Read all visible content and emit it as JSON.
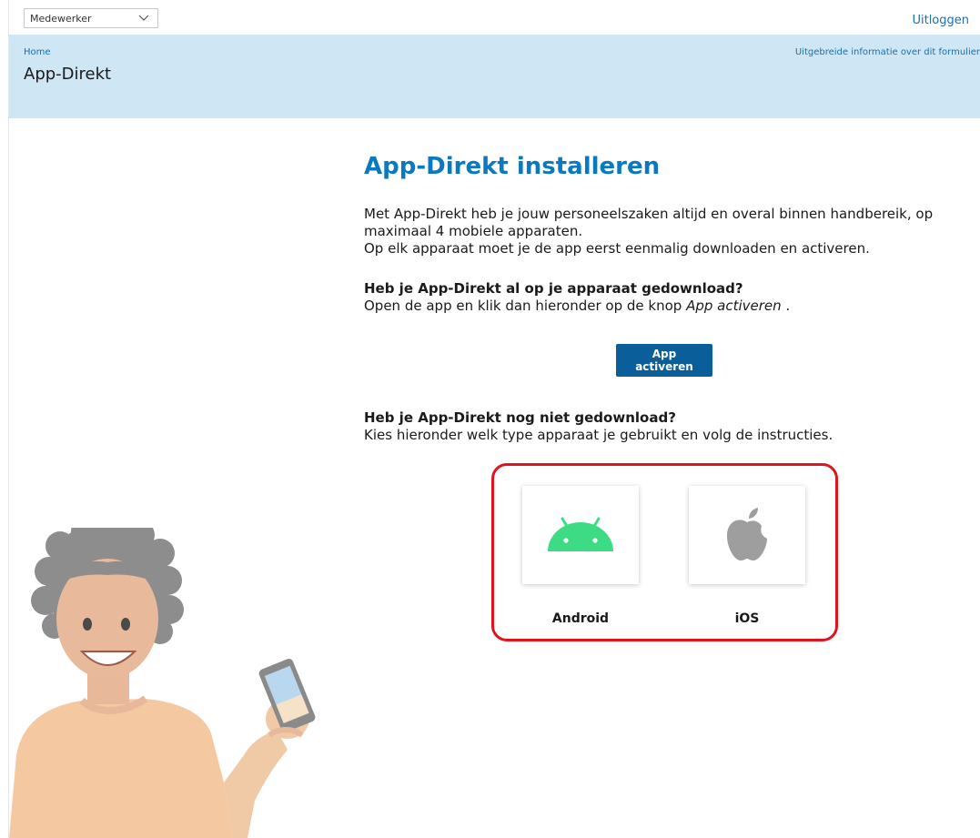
{
  "topbar": {
    "role_select_value": "Medewerker",
    "logout_label": "Uitloggen"
  },
  "header": {
    "breadcrumb": "Home",
    "title": "App-Direkt",
    "info_link": "Uitgebreide informatie over dit formulier"
  },
  "main": {
    "heading": "App-Direkt installeren",
    "intro_line1": "Met App-Direkt heb je jouw personeelszaken altijd en overal binnen handbereik, op maximaal 4 mobiele apparaten.",
    "intro_line2": "Op elk apparaat moet je de app eerst eenmalig downloaden en activeren.",
    "q1_title": "Heb je App-Direkt al op je apparaat gedownload?",
    "q1_text_before": "Open de app en klik dan hieronder op de knop ",
    "q1_text_em": "App activeren",
    "q1_text_after": " .",
    "activate_button": "App activeren",
    "q2_title": "Heb je App-Direkt nog niet gedownload?",
    "q2_text": "Kies hieronder welk type apparaat je gebruikt en volg de instructies.",
    "devices": [
      {
        "label": "Android",
        "icon": "android-icon"
      },
      {
        "label": "iOS",
        "icon": "apple-icon"
      }
    ]
  },
  "colors": {
    "accent": "#0a79c0",
    "header_bg": "#cfe6f4",
    "button_bg": "#0a5f9a",
    "highlight": "#e1141d",
    "android_green": "#3ddc84",
    "apple_grey": "#9e9e9e"
  }
}
